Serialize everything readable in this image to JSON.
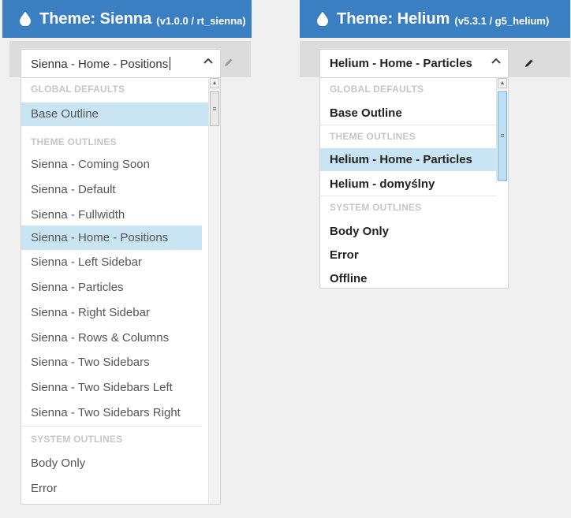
{
  "left": {
    "header": {
      "title": "Theme: Sienna",
      "version": "(v1.0.0 / rt_sienna)"
    },
    "select": {
      "value": "Sienna - Home - Positions",
      "icon": "chevron-up-icon"
    },
    "edit_icon": "pencil-icon",
    "groups": {
      "global": "Global Defaults",
      "theme": "Theme Outlines",
      "system": "System Outlines"
    },
    "global_items": [
      "Base Outline"
    ],
    "theme_items": [
      "Sienna - Coming Soon",
      "Sienna - Default",
      "Sienna - Fullwidth",
      "Sienna - Home - Positions",
      "Sienna - Left Sidebar",
      "Sienna - Particles",
      "Sienna - Right Sidebar",
      "Sienna - Rows & Columns",
      "Sienna - Two Sidebars",
      "Sienna - Two Sidebars Left",
      "Sienna - Two Sidebars Right"
    ],
    "system_items": [
      "Body Only",
      "Error"
    ]
  },
  "right": {
    "header": {
      "title": "Theme: Helium",
      "version": "(v5.3.1 / g5_helium)"
    },
    "select": {
      "value": "Helium - Home - Particles",
      "icon": "chevron-up-icon"
    },
    "edit_icon": "pencil-icon",
    "groups": {
      "global": "Global Defaults",
      "theme": "Theme Outlines",
      "system": "System Outlines"
    },
    "global_items": [
      "Base Outline"
    ],
    "theme_items": [
      "Helium - Home - Particles",
      "Helium - domyślny"
    ],
    "system_items": [
      "Body Only",
      "Error",
      "Offline"
    ]
  },
  "colors": {
    "header": "#3a7fc1",
    "selected": "#c9e5f3",
    "group_label": "#c6c6c6"
  }
}
